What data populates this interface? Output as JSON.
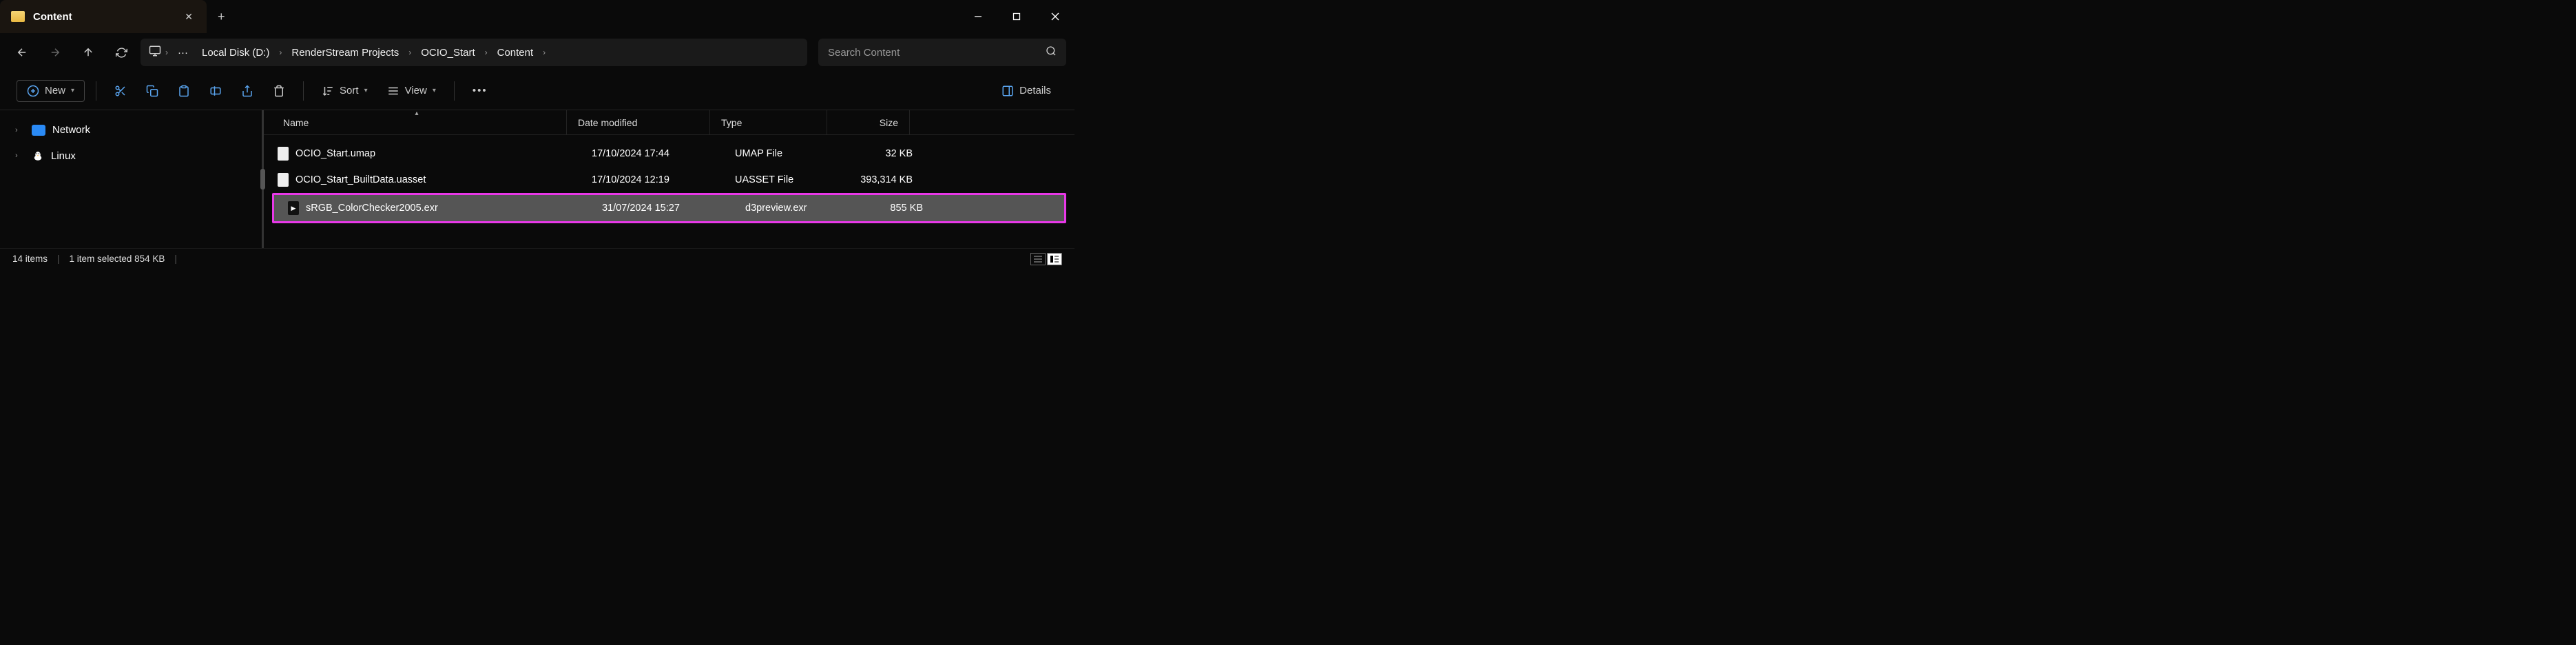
{
  "tab": {
    "title": "Content"
  },
  "breadcrumbs": [
    "Local Disk (D:)",
    "RenderStream Projects",
    "OCIO_Start",
    "Content"
  ],
  "search": {
    "placeholder": "Search Content"
  },
  "toolbar": {
    "new_label": "New",
    "sort_label": "Sort",
    "view_label": "View",
    "details_label": "Details"
  },
  "sidebar": {
    "items": [
      {
        "label": "Network"
      },
      {
        "label": "Linux"
      }
    ]
  },
  "columns": {
    "name": "Name",
    "date": "Date modified",
    "type": "Type",
    "size": "Size"
  },
  "files": [
    {
      "name": "OCIO_Start.umap",
      "date": "17/10/2024 17:44",
      "type": "UMAP File",
      "size": "32 KB",
      "selected": false
    },
    {
      "name": "OCIO_Start_BuiltData.uasset",
      "date": "17/10/2024 12:19",
      "type": "UASSET File",
      "size": "393,314 KB",
      "selected": false
    },
    {
      "name": "sRGB_ColorChecker2005.exr",
      "date": "31/07/2024 15:27",
      "type": "d3preview.exr",
      "size": "855 KB",
      "selected": true
    }
  ],
  "status": {
    "count": "14 items",
    "selection": "1 item selected  854 KB"
  }
}
